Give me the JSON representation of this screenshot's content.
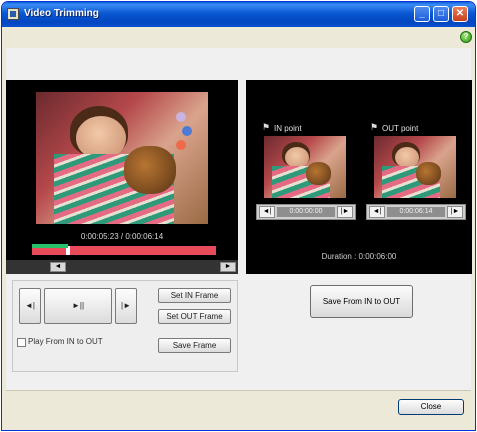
{
  "window": {
    "title": "Video Trimming",
    "minimize": "_",
    "maximize": "□",
    "close": "✕"
  },
  "help": {
    "label": "?"
  },
  "preview": {
    "timecode": "0:00:05:23 / 0:00:06:14"
  },
  "scroll": {
    "left": "◄",
    "right": "►"
  },
  "transport": {
    "prev": "◄|",
    "play": "►||",
    "next": "|►",
    "set_in": "Set IN Frame",
    "set_out": "Set OUT Frame",
    "save_frame": "Save Frame",
    "play_in_out": "Play From IN to OUT"
  },
  "in_frame": {
    "label": "IN point",
    "flag": "⚑",
    "prev": "◄|",
    "next": "|►",
    "value": "0:00:00:00"
  },
  "out_frame": {
    "label": "OUT point",
    "flag": "⚑",
    "prev": "◄|",
    "next": "|►",
    "value": "0:00:06:14"
  },
  "duration": "Duration : 0:00:06:00",
  "save_inout": "Save From IN to OUT",
  "close_label": "Close",
  "icons": {
    "app": "app-icon",
    "help": "help-icon",
    "flag": "flag-icon"
  },
  "colors": {
    "titlebar": "#0a58d2",
    "preview_bg": "#000000",
    "track_red": "#e94b5a",
    "track_green": "#27c06b"
  }
}
